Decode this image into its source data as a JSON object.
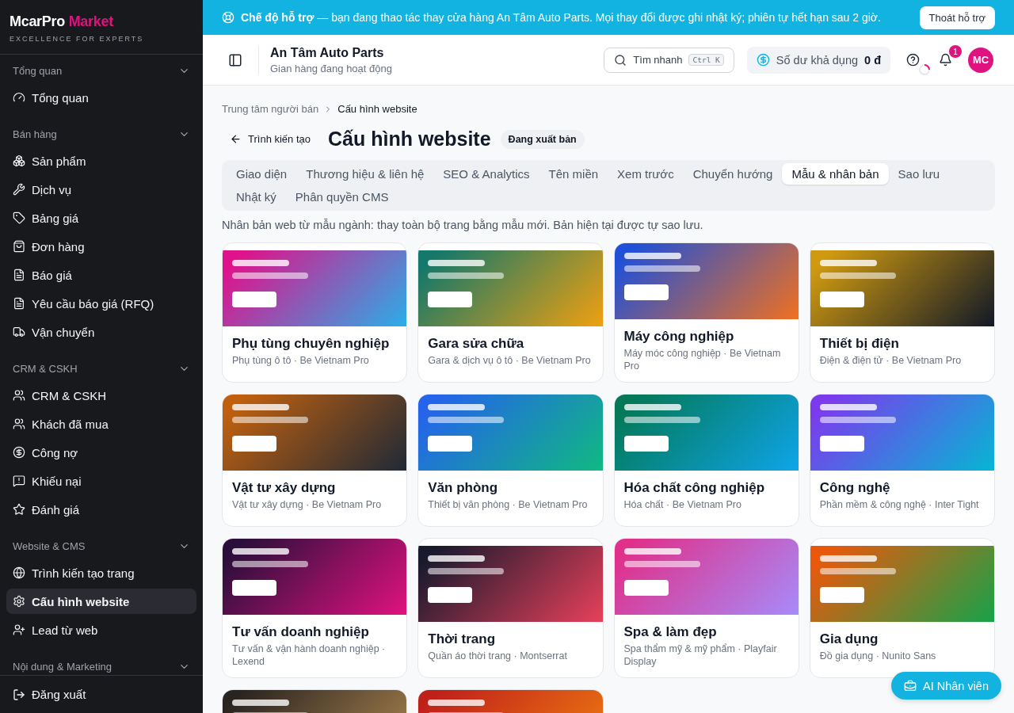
{
  "brand": {
    "name": "McarPro",
    "accent": "Market",
    "tagline": "EXCELLENCE FOR EXPERTS"
  },
  "sidebar": {
    "groups": [
      {
        "title": "Tổng quan",
        "expanded": true,
        "items": [
          {
            "label": "Tổng quan",
            "selected": false
          }
        ]
      },
      {
        "title": "Bán hàng",
        "expanded": true,
        "items": [
          {
            "label": "Sản phẩm",
            "selected": false
          },
          {
            "label": "Dịch vụ",
            "selected": false
          },
          {
            "label": "Bảng giá",
            "selected": false
          },
          {
            "label": "Đơn hàng",
            "selected": false
          },
          {
            "label": "Báo giá",
            "selected": false
          },
          {
            "label": "Yêu cầu báo giá (RFQ)",
            "selected": false
          },
          {
            "label": "Vận chuyển",
            "selected": false
          }
        ]
      },
      {
        "title": "CRM & CSKH",
        "expanded": true,
        "items": [
          {
            "label": "CRM & CSKH",
            "selected": false
          },
          {
            "label": "Khách đã mua",
            "selected": false
          },
          {
            "label": "Công nợ",
            "selected": false
          },
          {
            "label": "Khiếu nại",
            "selected": false
          },
          {
            "label": "Đánh giá",
            "selected": false
          }
        ]
      },
      {
        "title": "Website & CMS",
        "expanded": true,
        "items": [
          {
            "label": "Trình kiến tạo trang",
            "selected": false
          },
          {
            "label": "Cấu hình website",
            "selected": true
          },
          {
            "label": "Lead từ web",
            "selected": false
          }
        ]
      },
      {
        "title": "Nội dung & Marketing",
        "expanded": true
      }
    ],
    "logout": "Đăng xuất"
  },
  "banner": {
    "strong": "Chế độ hỗ trợ",
    "text": "— bạn đang thao tác thay cửa hàng An Tâm Auto Parts. Mọi thay đổi được ghi nhật ký; phiên tự hết hạn sau 2 giờ.",
    "button": "Thoát hỗ trợ"
  },
  "header": {
    "store": "An Tâm Auto Parts",
    "status": "Gian hàng đang hoạt động",
    "search": "Tìm nhanh",
    "shortcut": "Ctrl K",
    "balance_label": "Số dư khả dụng",
    "balance": "0 đ",
    "notifications": "1",
    "avatar": "MC"
  },
  "breadcrumb": [
    "Trung tâm người bán",
    "Cấu hình website"
  ],
  "back": "Trình kiến tạo",
  "title": "Cấu hình website",
  "badge": "Đang xuất bản",
  "tabs": [
    {
      "label": "Giao diện",
      "selected": false
    },
    {
      "label": "Thương hiệu & liên hệ",
      "selected": false
    },
    {
      "label": "SEO & Analytics",
      "selected": false
    },
    {
      "label": "Tên miền",
      "selected": false
    },
    {
      "label": "Xem trước",
      "selected": false
    },
    {
      "label": "Chuyển hướng",
      "selected": false
    },
    {
      "label": "Mẫu & nhân bản",
      "selected": true
    },
    {
      "label": "Sao lưu",
      "selected": false
    },
    {
      "label": "Nhật ký",
      "selected": false
    },
    {
      "label": "Phân quyền CMS",
      "selected": false
    }
  ],
  "description": "Nhân bản web từ mẫu ngành: thay toàn bộ trang bằng mẫu mới. Bản hiện tại được tự sao lưu.",
  "templates": [
    {
      "name": "Phụ tùng chuyên nghiệp",
      "meta": "Phụ tùng ô tô · Be Vietnam Pro",
      "color": "#e0128a"
    },
    {
      "name": "Gara sửa chữa",
      "meta": "Gara & dịch vụ ô tô · Be Vietnam Pro",
      "color": "#14786a"
    },
    {
      "name": "Máy công nghiệp",
      "meta": "Máy móc công nghiệp · Be Vietnam Pro",
      "color": "#2050d8"
    },
    {
      "name": "Thiết bị điện",
      "meta": "Điện & điện tử · Be Vietnam Pro",
      "color": "#d09a10"
    },
    {
      "name": "Vật tư xây dựng",
      "meta": "Vật tư xây dựng · Be Vietnam Pro",
      "color": "#c0600f"
    },
    {
      "name": "Văn phòng",
      "meta": "Thiết bị văn phòng · Be Vietnam Pro",
      "color": "#2563eb"
    },
    {
      "name": "Hóa chất công nghiệp",
      "meta": "Hóa chất · Be Vietnam Pro",
      "color": "#047857"
    },
    {
      "name": "Công nghệ",
      "meta": "Phần mềm & công nghệ · Inter Tight",
      "color": "#7c3aed"
    },
    {
      "name": "Tư vấn doanh nghiệp",
      "meta": "Tư vấn & vận hành doanh nghiệp · Lexend",
      "color": "#2a0f3a"
    },
    {
      "name": "Thời trang",
      "meta": "Quần áo thời trang · Montserrat",
      "color": "#1a1a2e"
    },
    {
      "name": "Spa & làm đẹp",
      "meta": "Spa thẩm mỹ & mỹ phẩm · Playfair Display",
      "color": "#e0308a"
    },
    {
      "name": "Gia dụng",
      "meta": "Đồ gia dụng · Nunito Sans",
      "color": "#ea580c"
    },
    {
      "color": "#2a2420"
    },
    {
      "color": "#c0201a"
    }
  ],
  "fab": "AI Nhân viên"
}
